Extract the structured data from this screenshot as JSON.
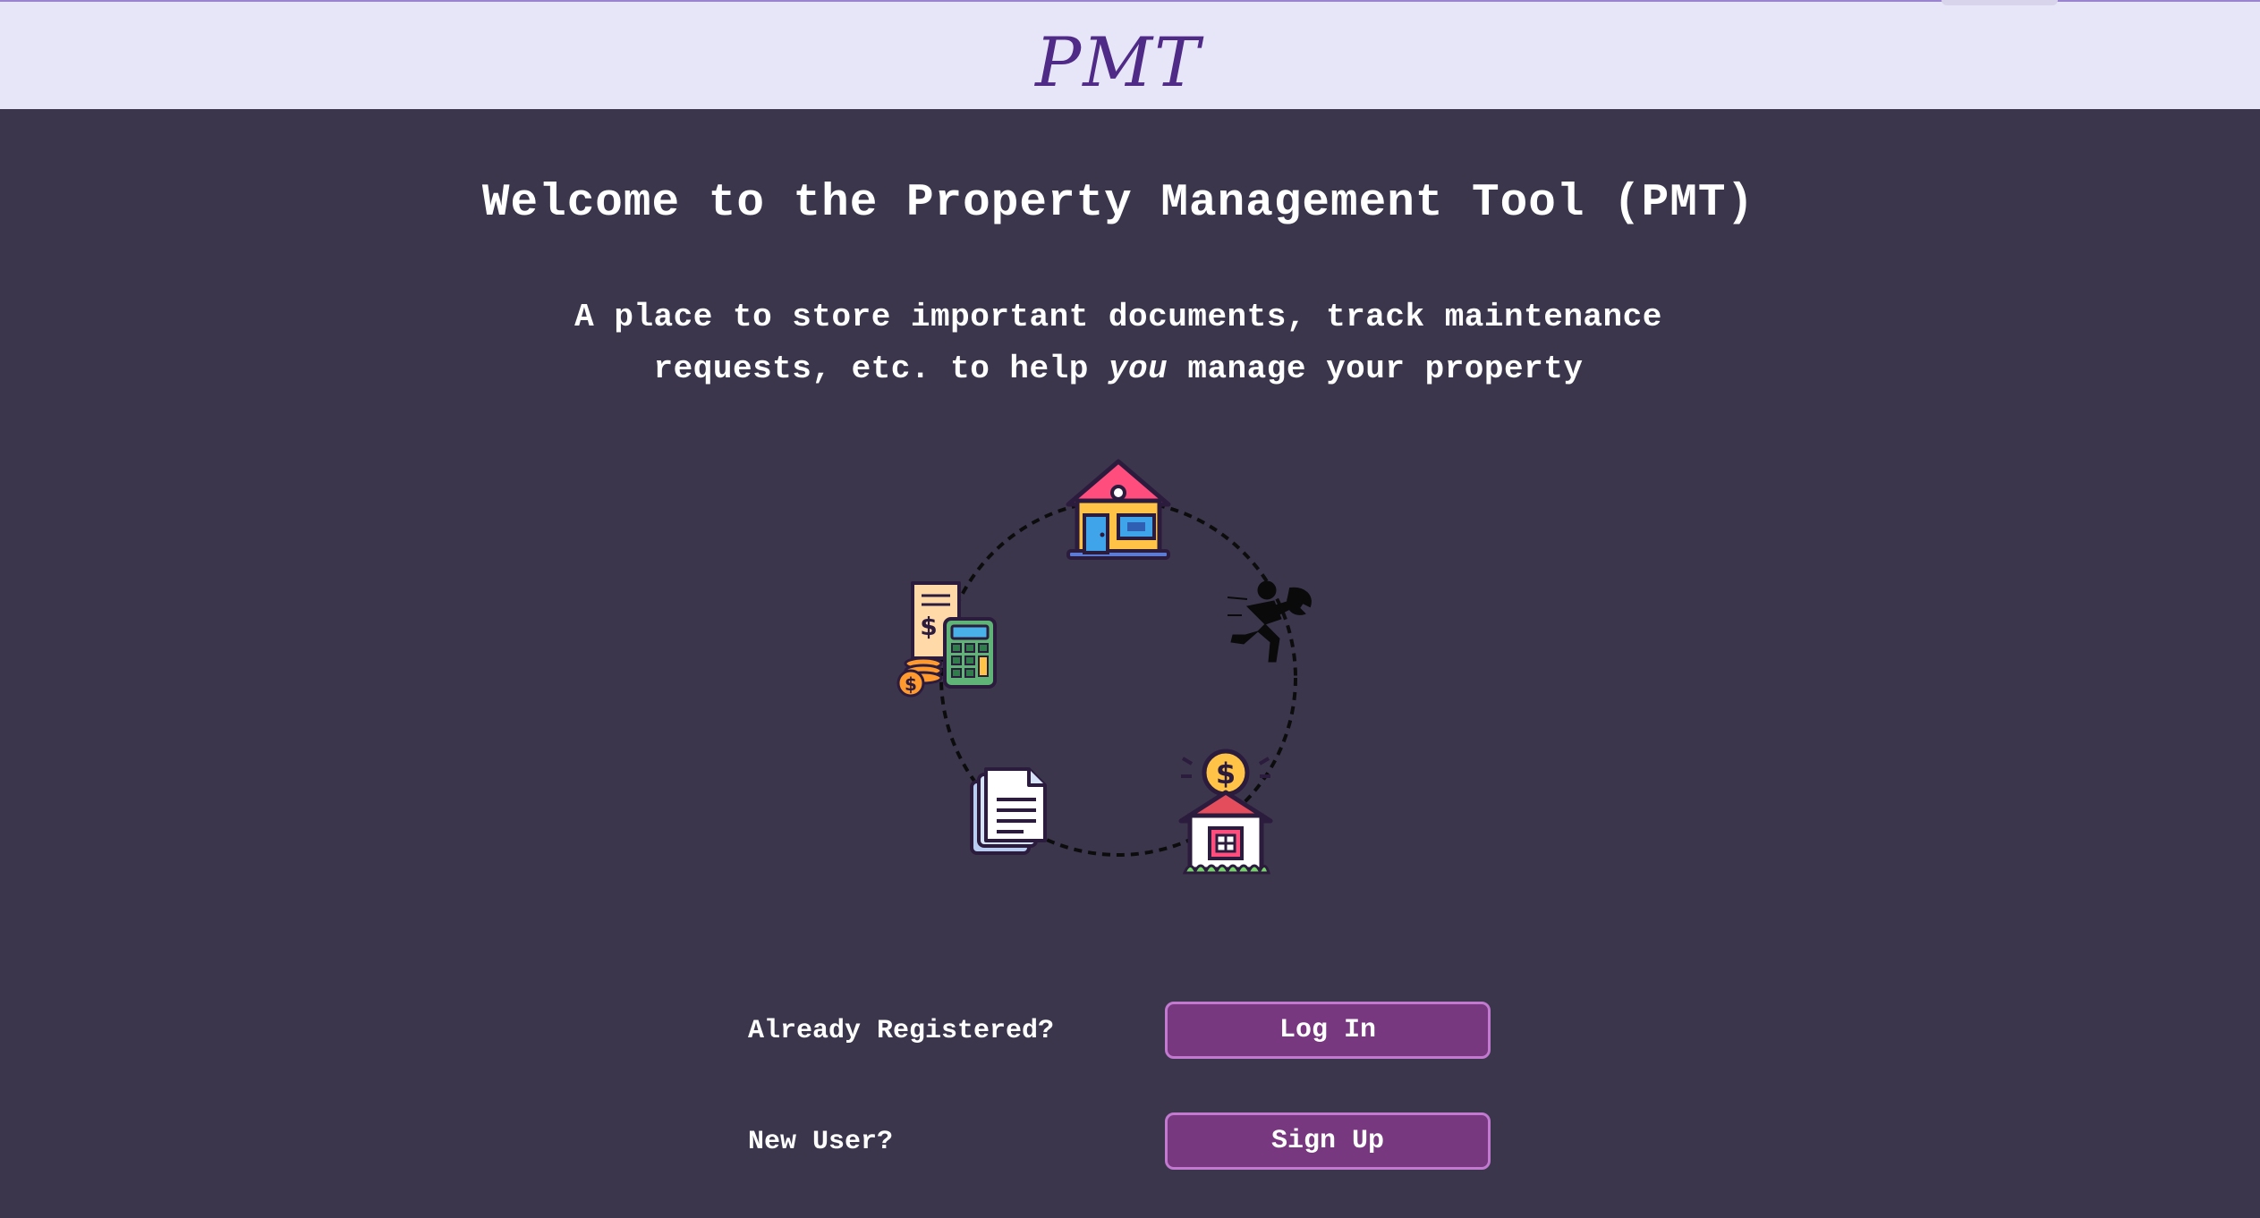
{
  "header": {
    "logo_text": "PMT"
  },
  "welcome": {
    "title": "Welcome to the Property Management Tool (PMT)",
    "subtitle_before": "A place to store important documents, track maintenance requests, etc. to help ",
    "subtitle_emphasis": "you",
    "subtitle_after": " manage your property"
  },
  "diagram": {
    "icons": [
      "house-icon",
      "repair-worker-icon",
      "house-income-icon",
      "documents-icon",
      "accounting-calculator-icon"
    ]
  },
  "auth": {
    "login_prompt": "Already Registered?",
    "login_button": "Log In",
    "signup_prompt": "New User?",
    "signup_button": "Sign Up"
  },
  "colors": {
    "background": "#3c364d",
    "header": "#e7e6f8",
    "logo": "#4f2a86",
    "button": "#78387f",
    "button_border": "#c17ad0"
  }
}
